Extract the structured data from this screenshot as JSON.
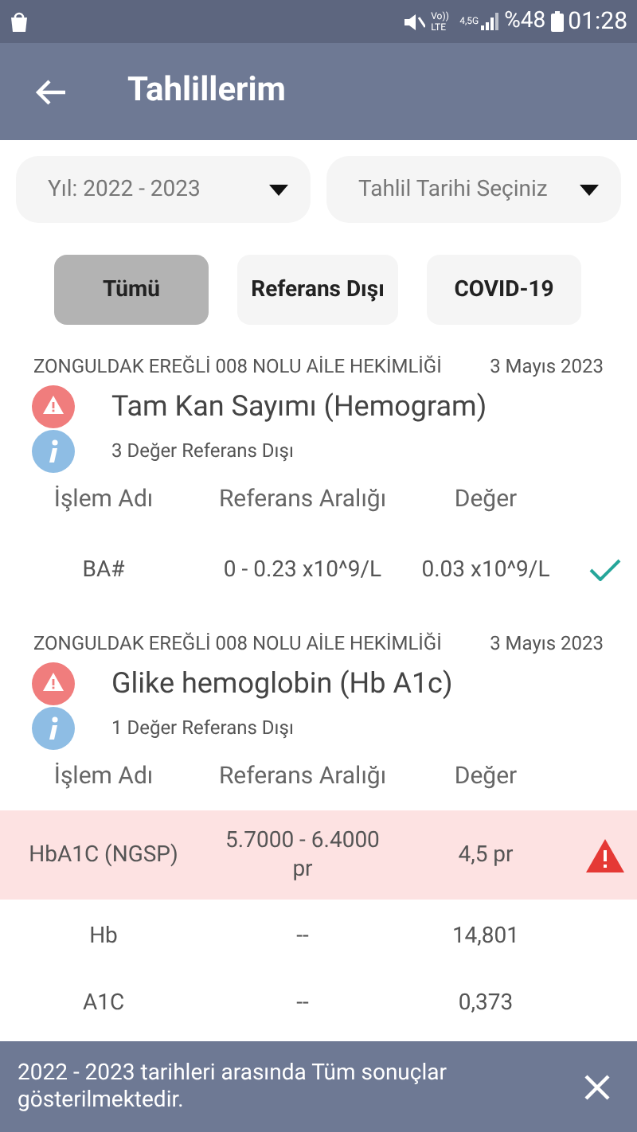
{
  "status_bar": {
    "network": "Vo)) LTE",
    "data": "4,5G",
    "battery": "%48",
    "time": "01:28"
  },
  "app_bar": {
    "title": "Tahlillerim"
  },
  "filters": [
    {
      "value": "Yıl: 2022 - 2023"
    },
    {
      "value": "Tahlil Tarihi Seçiniz"
    }
  ],
  "tabs": [
    {
      "label": "Tümü",
      "selected": true
    },
    {
      "label": "Referans Dışı",
      "selected": false
    },
    {
      "label": "COVID-19",
      "selected": false
    }
  ],
  "results": [
    {
      "institution": "ZONGULDAK EREĞLİ 008 NOLU AİLE HEKİMLİĞİ",
      "date": "3 Mayıs 2023",
      "title": "Tam Kan Sayımı (Hemogram)",
      "info": "3 Değer Referans Dışı",
      "columns": [
        "İşlem Adı",
        "Referans Aralığı",
        "Değer"
      ],
      "rows": [
        {
          "name": "BA#",
          "range": "0 - 0.23 x10^9/L",
          "value": "0.03 x10^9/L",
          "kind": "check"
        }
      ]
    },
    {
      "institution": "ZONGULDAK EREĞLİ 008 NOLU AİLE HEKİMLİĞİ",
      "date": "3 Mayıs 2023",
      "title": "Glike hemoglobin (Hb A1c)",
      "info": "1 Değer Referans Dışı",
      "columns": [
        "İşlem Adı",
        "Referans Aralığı",
        "Değer"
      ],
      "rows": [
        {
          "name": "HbA1C (NGSP)",
          "range": "5.7000 - 6.4000 pr",
          "value": "4,5 pr",
          "kind": "alert"
        },
        {
          "name": "Hb",
          "range": "--",
          "value": "14,801",
          "kind": "plain"
        },
        {
          "name": "A1C",
          "range": "--",
          "value": "0,373",
          "kind": "plain"
        }
      ]
    }
  ],
  "snackbar": {
    "message": "2022 - 2023 tarihleri arasında Tüm sonuçlar gösterilmektedir."
  }
}
